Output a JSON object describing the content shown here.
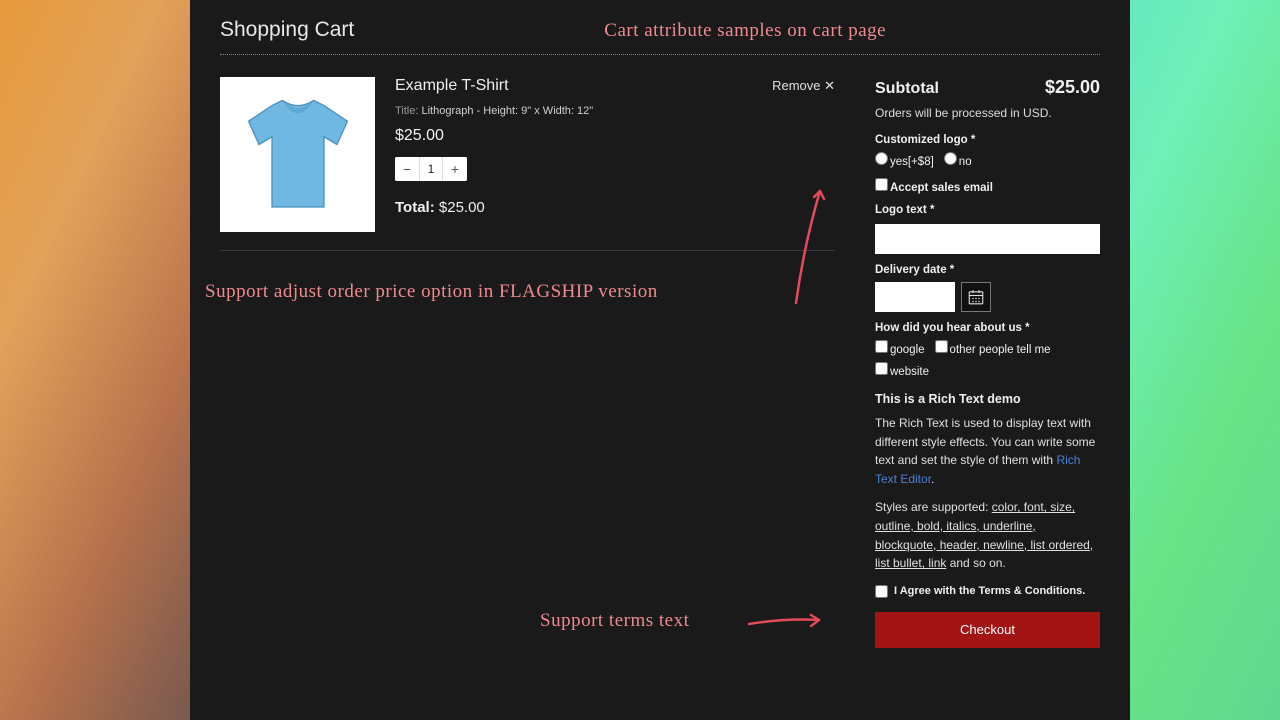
{
  "header": {
    "title": "Shopping Cart"
  },
  "annotations": {
    "top": "Cart attribute samples on cart page",
    "mid": "Support adjust order price option in FLAGSHIP version",
    "bottom": "Support terms text"
  },
  "item": {
    "title": "Example T-Shirt",
    "remove": "Remove ✕",
    "variant_label": "Title:",
    "variant_value": "Lithograph - Height: 9\" x Width: 12\"",
    "price": "$25.00",
    "qty": "1",
    "total_label": "Total:",
    "total_value": "$25.00"
  },
  "sidebar": {
    "subtotal_label": "Subtotal",
    "subtotal_value": "$25.00",
    "processing_note": "Orders will be processed in USD.",
    "custom_logo_label": "Customized logo *",
    "radio_yes": "yes[+$8]",
    "radio_no": "no",
    "accept_sales": "Accept sales email",
    "logo_text_label": "Logo text *",
    "delivery_label": "Delivery date *",
    "hear_label": "How did you hear about us *",
    "hear_opts": [
      "google",
      "other people tell me",
      "website"
    ],
    "rich_title": "This is a Rich Text demo",
    "rich_p1a": "The Rich Text is used to display text with different style effects. You can write some text and set the style of them with ",
    "rich_p1_link": "Rich Text Editor",
    "rich_p2a": "Styles are supported: ",
    "rich_p2_ul": "color, font, size, outline, bold, italics, underline, blockquote, header, newline, list ordered, list bullet, link",
    "rich_p2b": " and so on.",
    "terms": "I Agree with the Terms & Conditions.",
    "checkout": "Checkout"
  }
}
